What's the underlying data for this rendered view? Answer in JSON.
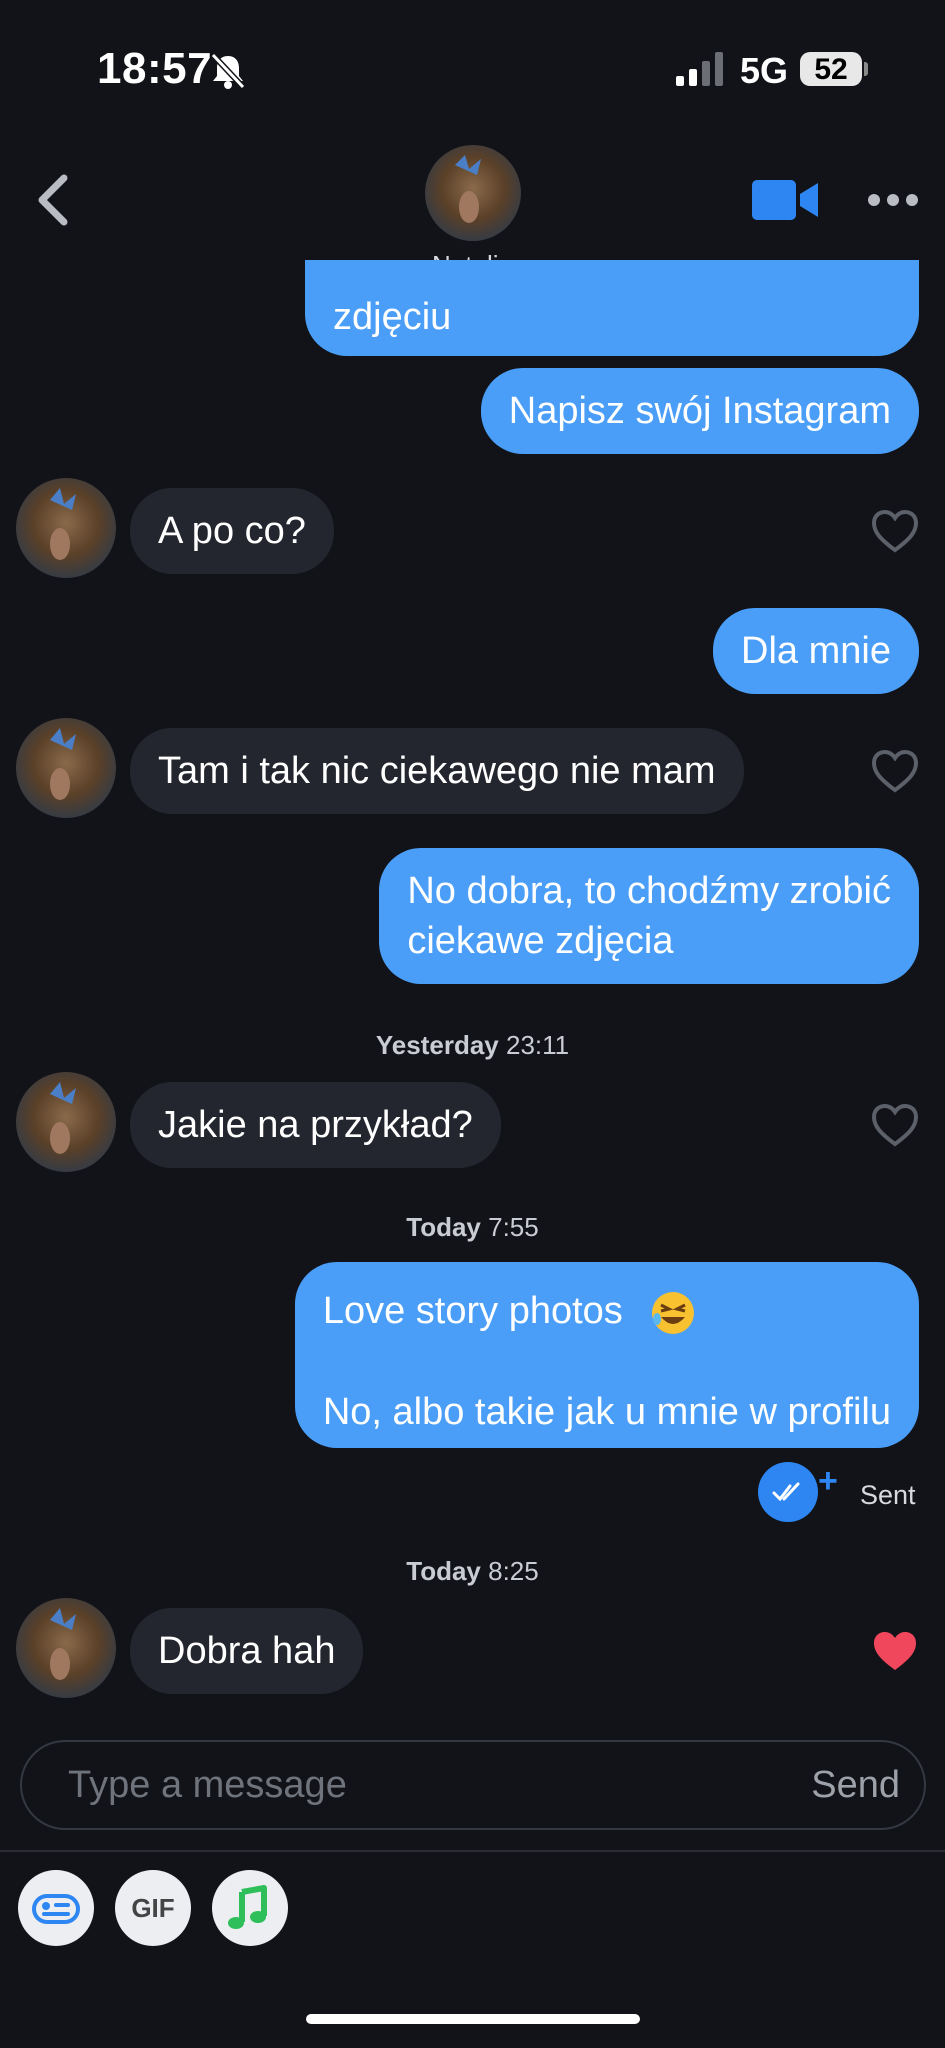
{
  "status_bar": {
    "time": "18:57",
    "network": "5G",
    "battery": "52"
  },
  "header": {
    "contact_name": "Natalia"
  },
  "messages": [
    {
      "dir": "out",
      "text": "zdjęciu"
    },
    {
      "dir": "out",
      "text": "Napisz swój Instagram"
    },
    {
      "dir": "in",
      "text": "A po co?"
    },
    {
      "dir": "out",
      "text": "Dla mnie"
    },
    {
      "dir": "in",
      "text": "Tam i tak nic ciekawego nie mam"
    },
    {
      "dir": "out",
      "line1": "No dobra, to chodźmy zrobić",
      "line2": "ciekawe zdjęcia"
    },
    {
      "dir": "in",
      "text": "Jakie na przykład?"
    },
    {
      "dir": "out",
      "line1": "Love story photos",
      "line2": "No, albo takie jak u mnie w profilu"
    },
    {
      "dir": "in",
      "text": "Dobra hah"
    }
  ],
  "timestamps": [
    {
      "day": "Yesterday",
      "time": "23:11"
    },
    {
      "day": "Today",
      "time": "7:55"
    },
    {
      "day": "Today",
      "time": "8:25"
    }
  ],
  "receipt": {
    "label": "Sent",
    "plus": "+"
  },
  "composer": {
    "placeholder": "Type a message",
    "send_label": "Send"
  },
  "tools": {
    "gif_label": "GIF"
  },
  "colors": {
    "outgoing": "#4a9ef8",
    "incoming": "#23262e",
    "background": "#111318",
    "liked_heart": "#f0475d"
  },
  "icons": [
    "bell-slash-icon",
    "signal-icon",
    "back-chevron-icon",
    "video-call-icon",
    "more-icon",
    "heart-icon",
    "laugh-emoji-icon",
    "double-check-icon",
    "card-icon",
    "music-note-icon"
  ]
}
